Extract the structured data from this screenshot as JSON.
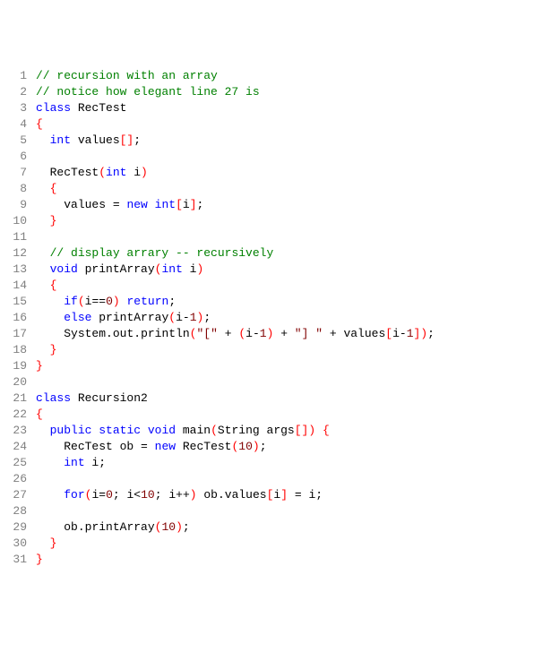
{
  "lines": [
    {
      "n": "1",
      "tokens": [
        {
          "c": "comment",
          "t": "// recursion with an array"
        }
      ]
    },
    {
      "n": "2",
      "tokens": [
        {
          "c": "comment",
          "t": "// notice how elegant line 27 is"
        }
      ]
    },
    {
      "n": "3",
      "tokens": [
        {
          "c": "keyword",
          "t": "class"
        },
        {
          "c": "ident",
          "t": " RecTest"
        }
      ]
    },
    {
      "n": "4",
      "tokens": [
        {
          "c": "brace",
          "t": "{"
        }
      ]
    },
    {
      "n": "5",
      "indent": "  ",
      "tokens": [
        {
          "c": "type",
          "t": "int"
        },
        {
          "c": "ident",
          "t": " values"
        },
        {
          "c": "bracket",
          "t": "[]"
        },
        {
          "c": "semi",
          "t": ";"
        }
      ]
    },
    {
      "n": "6",
      "tokens": []
    },
    {
      "n": "7",
      "indent": "  ",
      "tokens": [
        {
          "c": "ident",
          "t": "RecTest"
        },
        {
          "c": "paren",
          "t": "("
        },
        {
          "c": "type",
          "t": "int"
        },
        {
          "c": "ident",
          "t": " i"
        },
        {
          "c": "paren",
          "t": ")"
        }
      ]
    },
    {
      "n": "8",
      "indent": "  ",
      "tokens": [
        {
          "c": "brace",
          "t": "{"
        }
      ]
    },
    {
      "n": "9",
      "indent": "    ",
      "tokens": [
        {
          "c": "ident",
          "t": "values "
        },
        {
          "c": "op",
          "t": "= "
        },
        {
          "c": "keyword",
          "t": "new"
        },
        {
          "c": "ident",
          "t": " "
        },
        {
          "c": "type",
          "t": "int"
        },
        {
          "c": "bracket",
          "t": "["
        },
        {
          "c": "ident",
          "t": "i"
        },
        {
          "c": "bracket",
          "t": "]"
        },
        {
          "c": "semi",
          "t": ";"
        }
      ]
    },
    {
      "n": "10",
      "indent": "  ",
      "tokens": [
        {
          "c": "brace",
          "t": "}"
        }
      ]
    },
    {
      "n": "11",
      "tokens": []
    },
    {
      "n": "12",
      "indent": "  ",
      "tokens": [
        {
          "c": "comment",
          "t": "// display arrary -- recursively"
        }
      ]
    },
    {
      "n": "13",
      "indent": "  ",
      "tokens": [
        {
          "c": "type",
          "t": "void"
        },
        {
          "c": "ident",
          "t": " printArray"
        },
        {
          "c": "paren",
          "t": "("
        },
        {
          "c": "type",
          "t": "int"
        },
        {
          "c": "ident",
          "t": " i"
        },
        {
          "c": "paren",
          "t": ")"
        }
      ]
    },
    {
      "n": "14",
      "indent": "  ",
      "tokens": [
        {
          "c": "brace",
          "t": "{"
        }
      ]
    },
    {
      "n": "15",
      "indent": "    ",
      "tokens": [
        {
          "c": "keyword",
          "t": "if"
        },
        {
          "c": "paren",
          "t": "("
        },
        {
          "c": "ident",
          "t": "i"
        },
        {
          "c": "op",
          "t": "=="
        },
        {
          "c": "number",
          "t": "0"
        },
        {
          "c": "paren",
          "t": ")"
        },
        {
          "c": "ident",
          "t": " "
        },
        {
          "c": "keyword",
          "t": "return"
        },
        {
          "c": "semi",
          "t": ";"
        }
      ]
    },
    {
      "n": "16",
      "indent": "    ",
      "tokens": [
        {
          "c": "keyword",
          "t": "else"
        },
        {
          "c": "ident",
          "t": " printArray"
        },
        {
          "c": "paren",
          "t": "("
        },
        {
          "c": "ident",
          "t": "i"
        },
        {
          "c": "op",
          "t": "-"
        },
        {
          "c": "number",
          "t": "1"
        },
        {
          "c": "paren",
          "t": ")"
        },
        {
          "c": "semi",
          "t": ";"
        }
      ]
    },
    {
      "n": "17",
      "indent": "    ",
      "tokens": [
        {
          "c": "ident",
          "t": "System"
        },
        {
          "c": "dot",
          "t": "."
        },
        {
          "c": "ident",
          "t": "out"
        },
        {
          "c": "dot",
          "t": "."
        },
        {
          "c": "ident",
          "t": "println"
        },
        {
          "c": "paren",
          "t": "("
        },
        {
          "c": "string",
          "t": "\"[\""
        },
        {
          "c": "ident",
          "t": " "
        },
        {
          "c": "op",
          "t": "+ "
        },
        {
          "c": "paren",
          "t": "("
        },
        {
          "c": "ident",
          "t": "i"
        },
        {
          "c": "op",
          "t": "-"
        },
        {
          "c": "number",
          "t": "1"
        },
        {
          "c": "paren",
          "t": ")"
        },
        {
          "c": "ident",
          "t": " "
        },
        {
          "c": "op",
          "t": "+ "
        },
        {
          "c": "string",
          "t": "\"] \""
        },
        {
          "c": "ident",
          "t": " "
        },
        {
          "c": "op",
          "t": "+ "
        },
        {
          "c": "ident",
          "t": "values"
        },
        {
          "c": "bracket",
          "t": "["
        },
        {
          "c": "ident",
          "t": "i"
        },
        {
          "c": "op",
          "t": "-"
        },
        {
          "c": "number",
          "t": "1"
        },
        {
          "c": "bracket",
          "t": "]"
        },
        {
          "c": "paren",
          "t": ")"
        },
        {
          "c": "semi",
          "t": ";"
        }
      ]
    },
    {
      "n": "18",
      "indent": "  ",
      "tokens": [
        {
          "c": "brace",
          "t": "}"
        }
      ]
    },
    {
      "n": "19",
      "tokens": [
        {
          "c": "brace",
          "t": "}"
        }
      ]
    },
    {
      "n": "20",
      "tokens": []
    },
    {
      "n": "21",
      "tokens": [
        {
          "c": "keyword",
          "t": "class"
        },
        {
          "c": "ident",
          "t": " Recursion2"
        }
      ]
    },
    {
      "n": "22",
      "tokens": [
        {
          "c": "brace",
          "t": "{"
        }
      ]
    },
    {
      "n": "23",
      "indent": "  ",
      "tokens": [
        {
          "c": "keyword",
          "t": "public"
        },
        {
          "c": "ident",
          "t": " "
        },
        {
          "c": "keyword",
          "t": "static"
        },
        {
          "c": "ident",
          "t": " "
        },
        {
          "c": "type",
          "t": "void"
        },
        {
          "c": "ident",
          "t": " main"
        },
        {
          "c": "paren",
          "t": "("
        },
        {
          "c": "ident",
          "t": "String args"
        },
        {
          "c": "bracket",
          "t": "[]"
        },
        {
          "c": "paren",
          "t": ")"
        },
        {
          "c": "ident",
          "t": " "
        },
        {
          "c": "brace",
          "t": "{"
        }
      ]
    },
    {
      "n": "24",
      "indent": "    ",
      "tokens": [
        {
          "c": "ident",
          "t": "RecTest ob "
        },
        {
          "c": "op",
          "t": "= "
        },
        {
          "c": "keyword",
          "t": "new"
        },
        {
          "c": "ident",
          "t": " RecTest"
        },
        {
          "c": "paren",
          "t": "("
        },
        {
          "c": "number",
          "t": "10"
        },
        {
          "c": "paren",
          "t": ")"
        },
        {
          "c": "semi",
          "t": ";"
        }
      ]
    },
    {
      "n": "25",
      "indent": "    ",
      "tokens": [
        {
          "c": "type",
          "t": "int"
        },
        {
          "c": "ident",
          "t": " i"
        },
        {
          "c": "semi",
          "t": ";"
        }
      ]
    },
    {
      "n": "26",
      "tokens": []
    },
    {
      "n": "27",
      "indent": "    ",
      "tokens": [
        {
          "c": "keyword",
          "t": "for"
        },
        {
          "c": "paren",
          "t": "("
        },
        {
          "c": "ident",
          "t": "i"
        },
        {
          "c": "op",
          "t": "="
        },
        {
          "c": "number",
          "t": "0"
        },
        {
          "c": "semi",
          "t": "; "
        },
        {
          "c": "ident",
          "t": "i"
        },
        {
          "c": "op",
          "t": "<"
        },
        {
          "c": "number",
          "t": "10"
        },
        {
          "c": "semi",
          "t": "; "
        },
        {
          "c": "ident",
          "t": "i"
        },
        {
          "c": "op",
          "t": "++"
        },
        {
          "c": "paren",
          "t": ")"
        },
        {
          "c": "ident",
          "t": " ob"
        },
        {
          "c": "dot",
          "t": "."
        },
        {
          "c": "ident",
          "t": "values"
        },
        {
          "c": "bracket",
          "t": "["
        },
        {
          "c": "ident",
          "t": "i"
        },
        {
          "c": "bracket",
          "t": "]"
        },
        {
          "c": "ident",
          "t": " "
        },
        {
          "c": "op",
          "t": "= "
        },
        {
          "c": "ident",
          "t": "i"
        },
        {
          "c": "semi",
          "t": ";"
        }
      ]
    },
    {
      "n": "28",
      "tokens": []
    },
    {
      "n": "29",
      "indent": "    ",
      "tokens": [
        {
          "c": "ident",
          "t": "ob"
        },
        {
          "c": "dot",
          "t": "."
        },
        {
          "c": "ident",
          "t": "printArray"
        },
        {
          "c": "paren",
          "t": "("
        },
        {
          "c": "number",
          "t": "10"
        },
        {
          "c": "paren",
          "t": ")"
        },
        {
          "c": "semi",
          "t": ";"
        }
      ]
    },
    {
      "n": "30",
      "indent": "  ",
      "tokens": [
        {
          "c": "brace",
          "t": "}"
        }
      ]
    },
    {
      "n": "31",
      "tokens": [
        {
          "c": "brace",
          "t": "}"
        }
      ]
    }
  ]
}
